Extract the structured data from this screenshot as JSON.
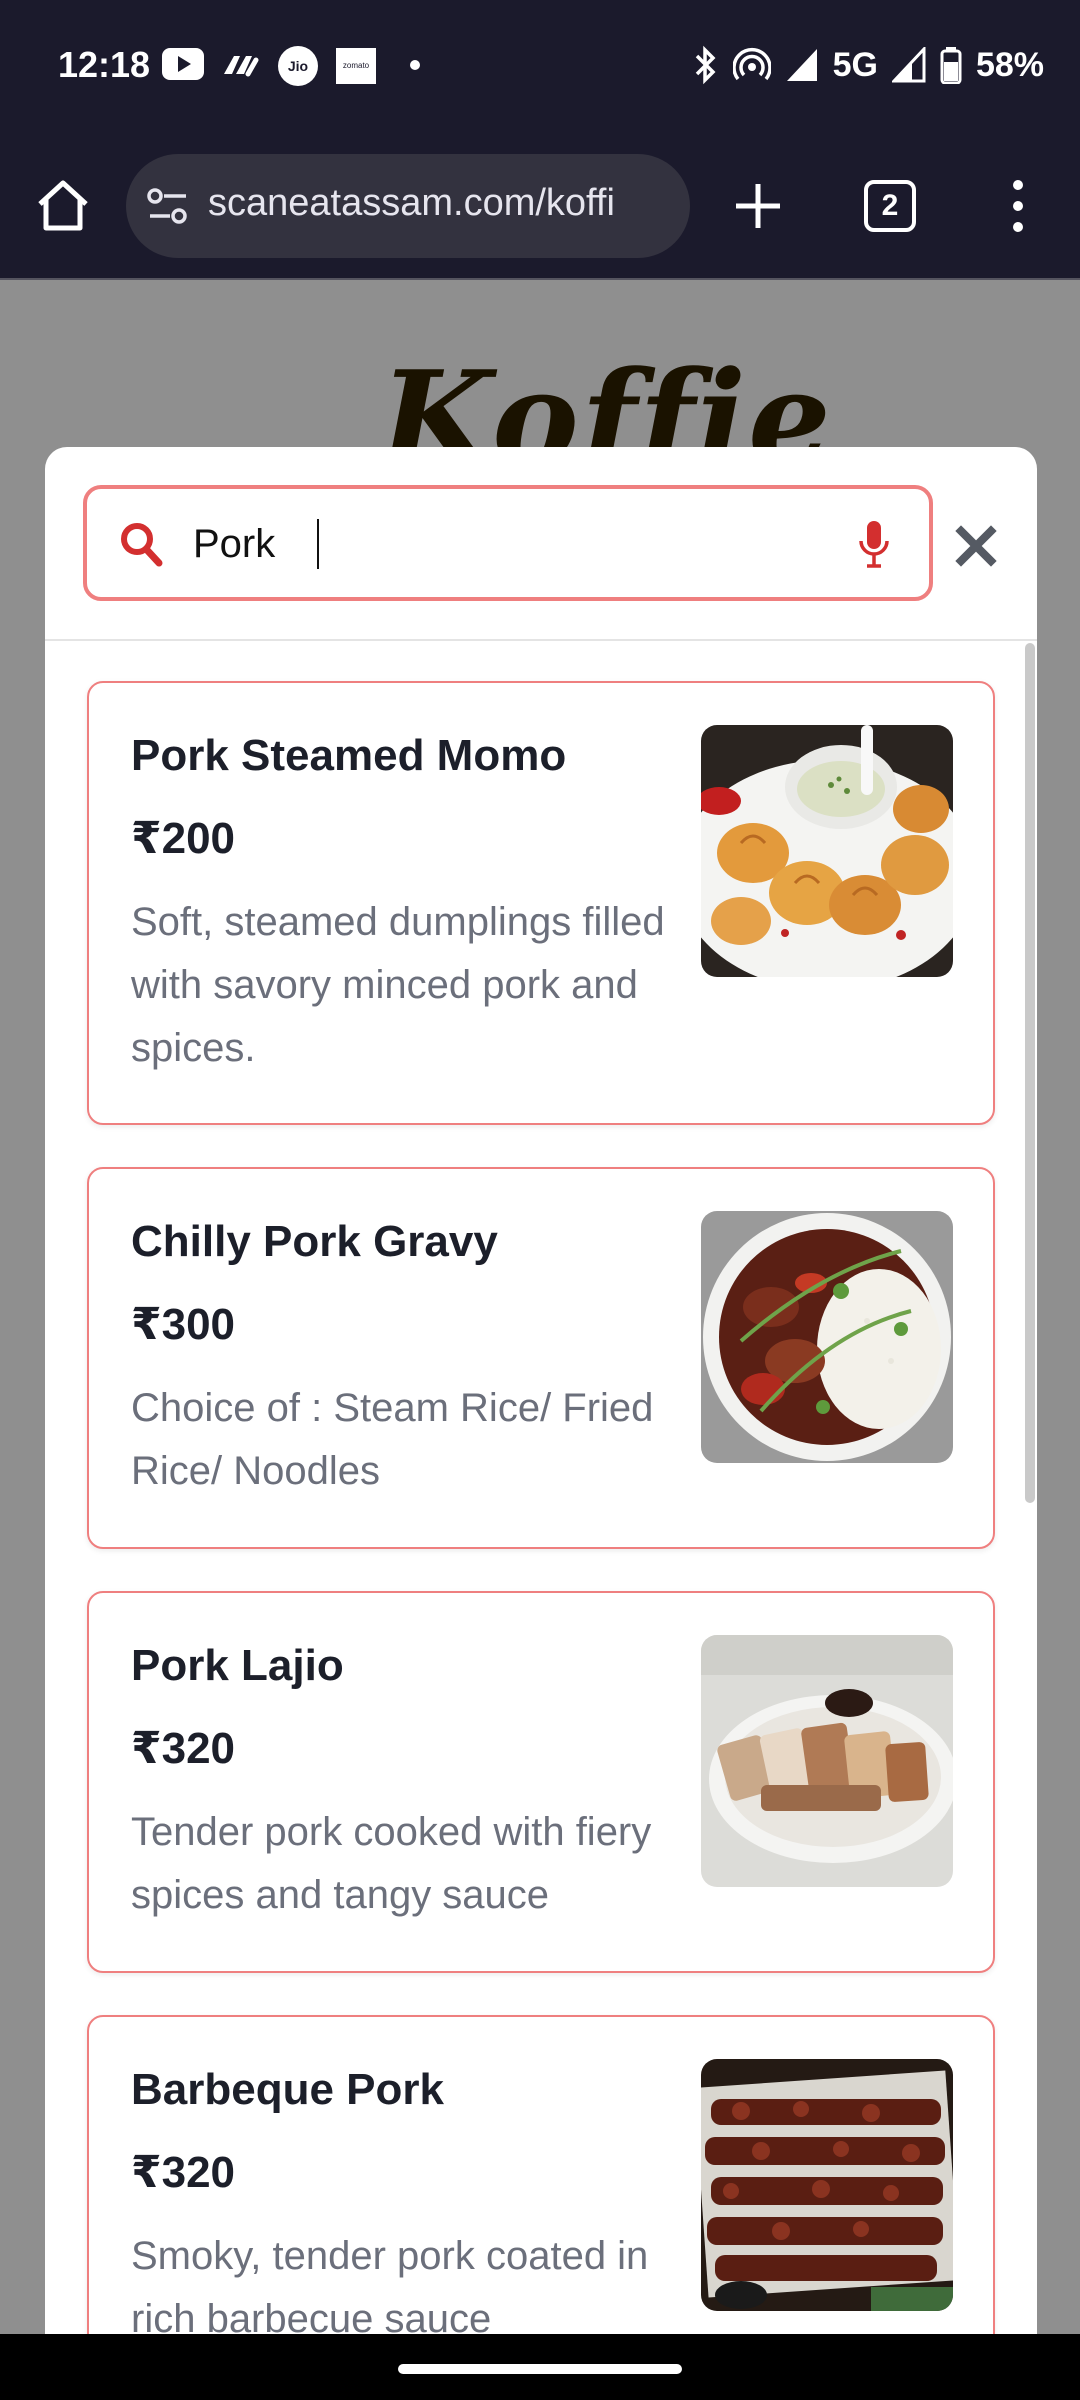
{
  "status_bar": {
    "time": "12:18",
    "jio_label": "Jio",
    "zomato_label": "zomato",
    "network": "5G",
    "battery": "58%",
    "icons": [
      "youtube-icon",
      "paytm-icon",
      "jio-icon",
      "zomato-icon",
      "bluetooth-icon",
      "hotspot-icon",
      "signal-icon",
      "battery-icon"
    ]
  },
  "browser": {
    "url": "scaneatassam.com/koffi",
    "tab_count": "2"
  },
  "page": {
    "logo_text": "Koffie"
  },
  "search": {
    "value": "Pork",
    "accent_color": "#d32f2f",
    "border_color": "#ef7f7f"
  },
  "results": [
    {
      "title": "Pork Steamed Momo",
      "price": "₹200",
      "description": "Soft, steamed dumplings filled with savory minced pork and spices."
    },
    {
      "title": "Chilly Pork Gravy",
      "price": "₹300",
      "description": "Choice of : Steam Rice/ Fried Rice/ Noodles"
    },
    {
      "title": "Pork Lajio",
      "price": "₹320",
      "description": "Tender pork cooked with fiery spices and tangy sauce"
    },
    {
      "title": "Barbeque Pork",
      "price": "₹320",
      "description": "Smoky, tender pork coated in rich barbecue sauce"
    }
  ]
}
